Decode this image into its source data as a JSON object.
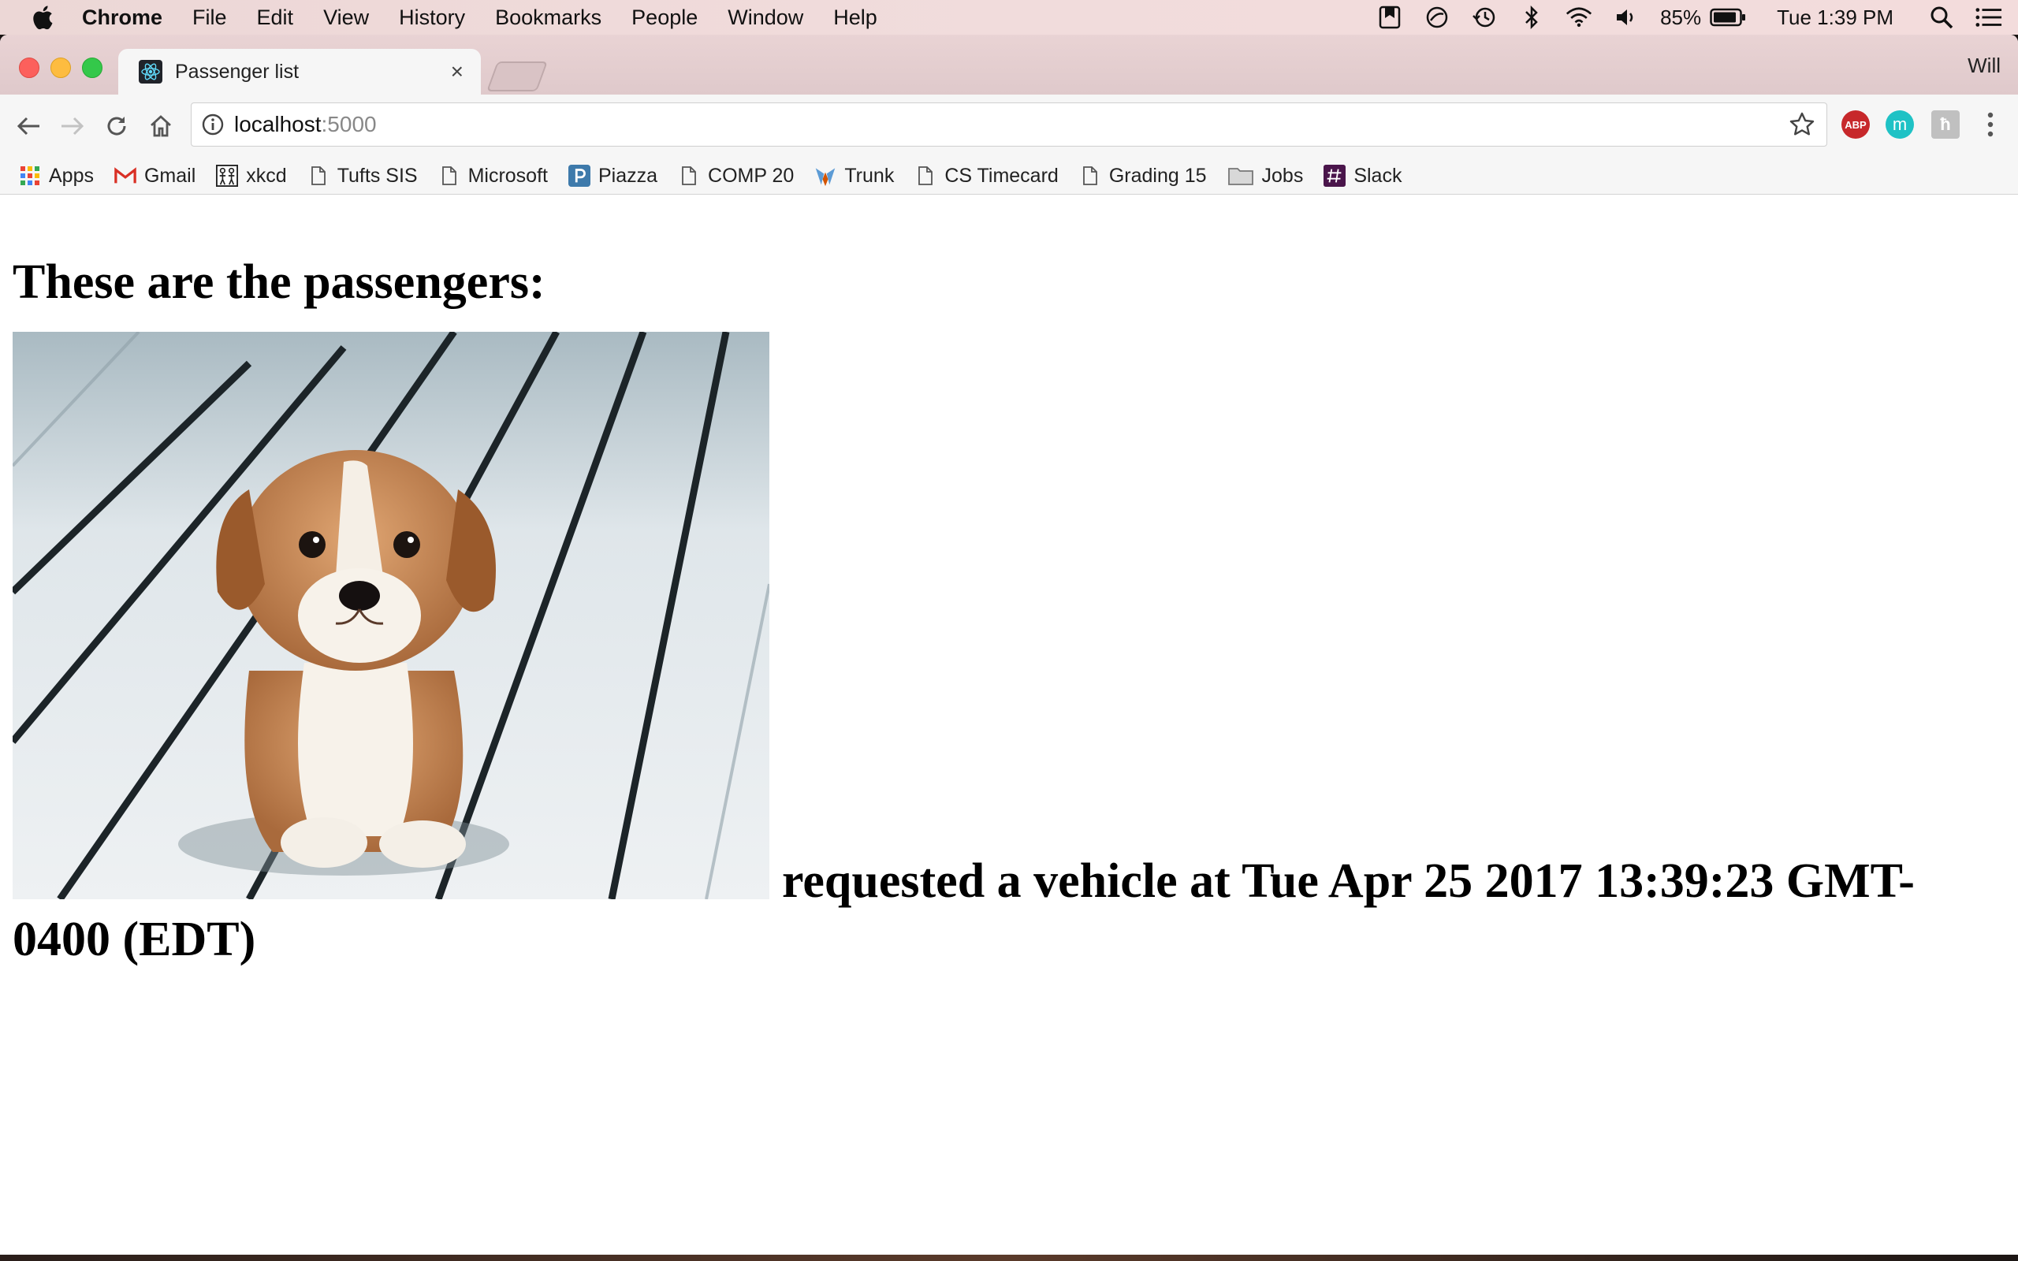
{
  "menubar": {
    "items": [
      "Chrome",
      "File",
      "Edit",
      "View",
      "History",
      "Bookmarks",
      "People",
      "Window",
      "Help"
    ],
    "battery": "85%",
    "clock": "Tue 1:39 PM"
  },
  "tab": {
    "title": "Passenger list",
    "close": "×"
  },
  "profile_name": "Will",
  "omnibox": {
    "host": "localhost",
    "port": ":5000"
  },
  "extensions": {
    "abp": "ABP",
    "m": "m",
    "hn": "ћ"
  },
  "bookmarks": [
    {
      "label": "Apps",
      "icon": "apps-grid-icon"
    },
    {
      "label": "Gmail",
      "icon": "gmail-icon"
    },
    {
      "label": "xkcd",
      "icon": "xkcd-icon"
    },
    {
      "label": "Tufts SIS",
      "icon": "page-icon"
    },
    {
      "label": "Microsoft",
      "icon": "page-icon"
    },
    {
      "label": "Piazza",
      "icon": "piazza-icon"
    },
    {
      "label": "COMP 20",
      "icon": "page-icon"
    },
    {
      "label": "Trunk",
      "icon": "trunk-icon"
    },
    {
      "label": "CS Timecard",
      "icon": "page-icon"
    },
    {
      "label": "Grading 15",
      "icon": "page-icon"
    },
    {
      "label": "Jobs",
      "icon": "folder-icon"
    },
    {
      "label": "Slack",
      "icon": "slack-icon"
    }
  ],
  "page": {
    "heading": "These are the passengers:",
    "request_line1": "requested a vehicle at Tue Apr 25 2017 13:39:23 GMT-",
    "request_line2": "0400 (EDT)"
  },
  "colors": {
    "close": "#fc605c",
    "minimize": "#fdbc40",
    "zoom": "#34c84a",
    "abp": "#c7282b",
    "mixmax": "#1fc2c5"
  }
}
